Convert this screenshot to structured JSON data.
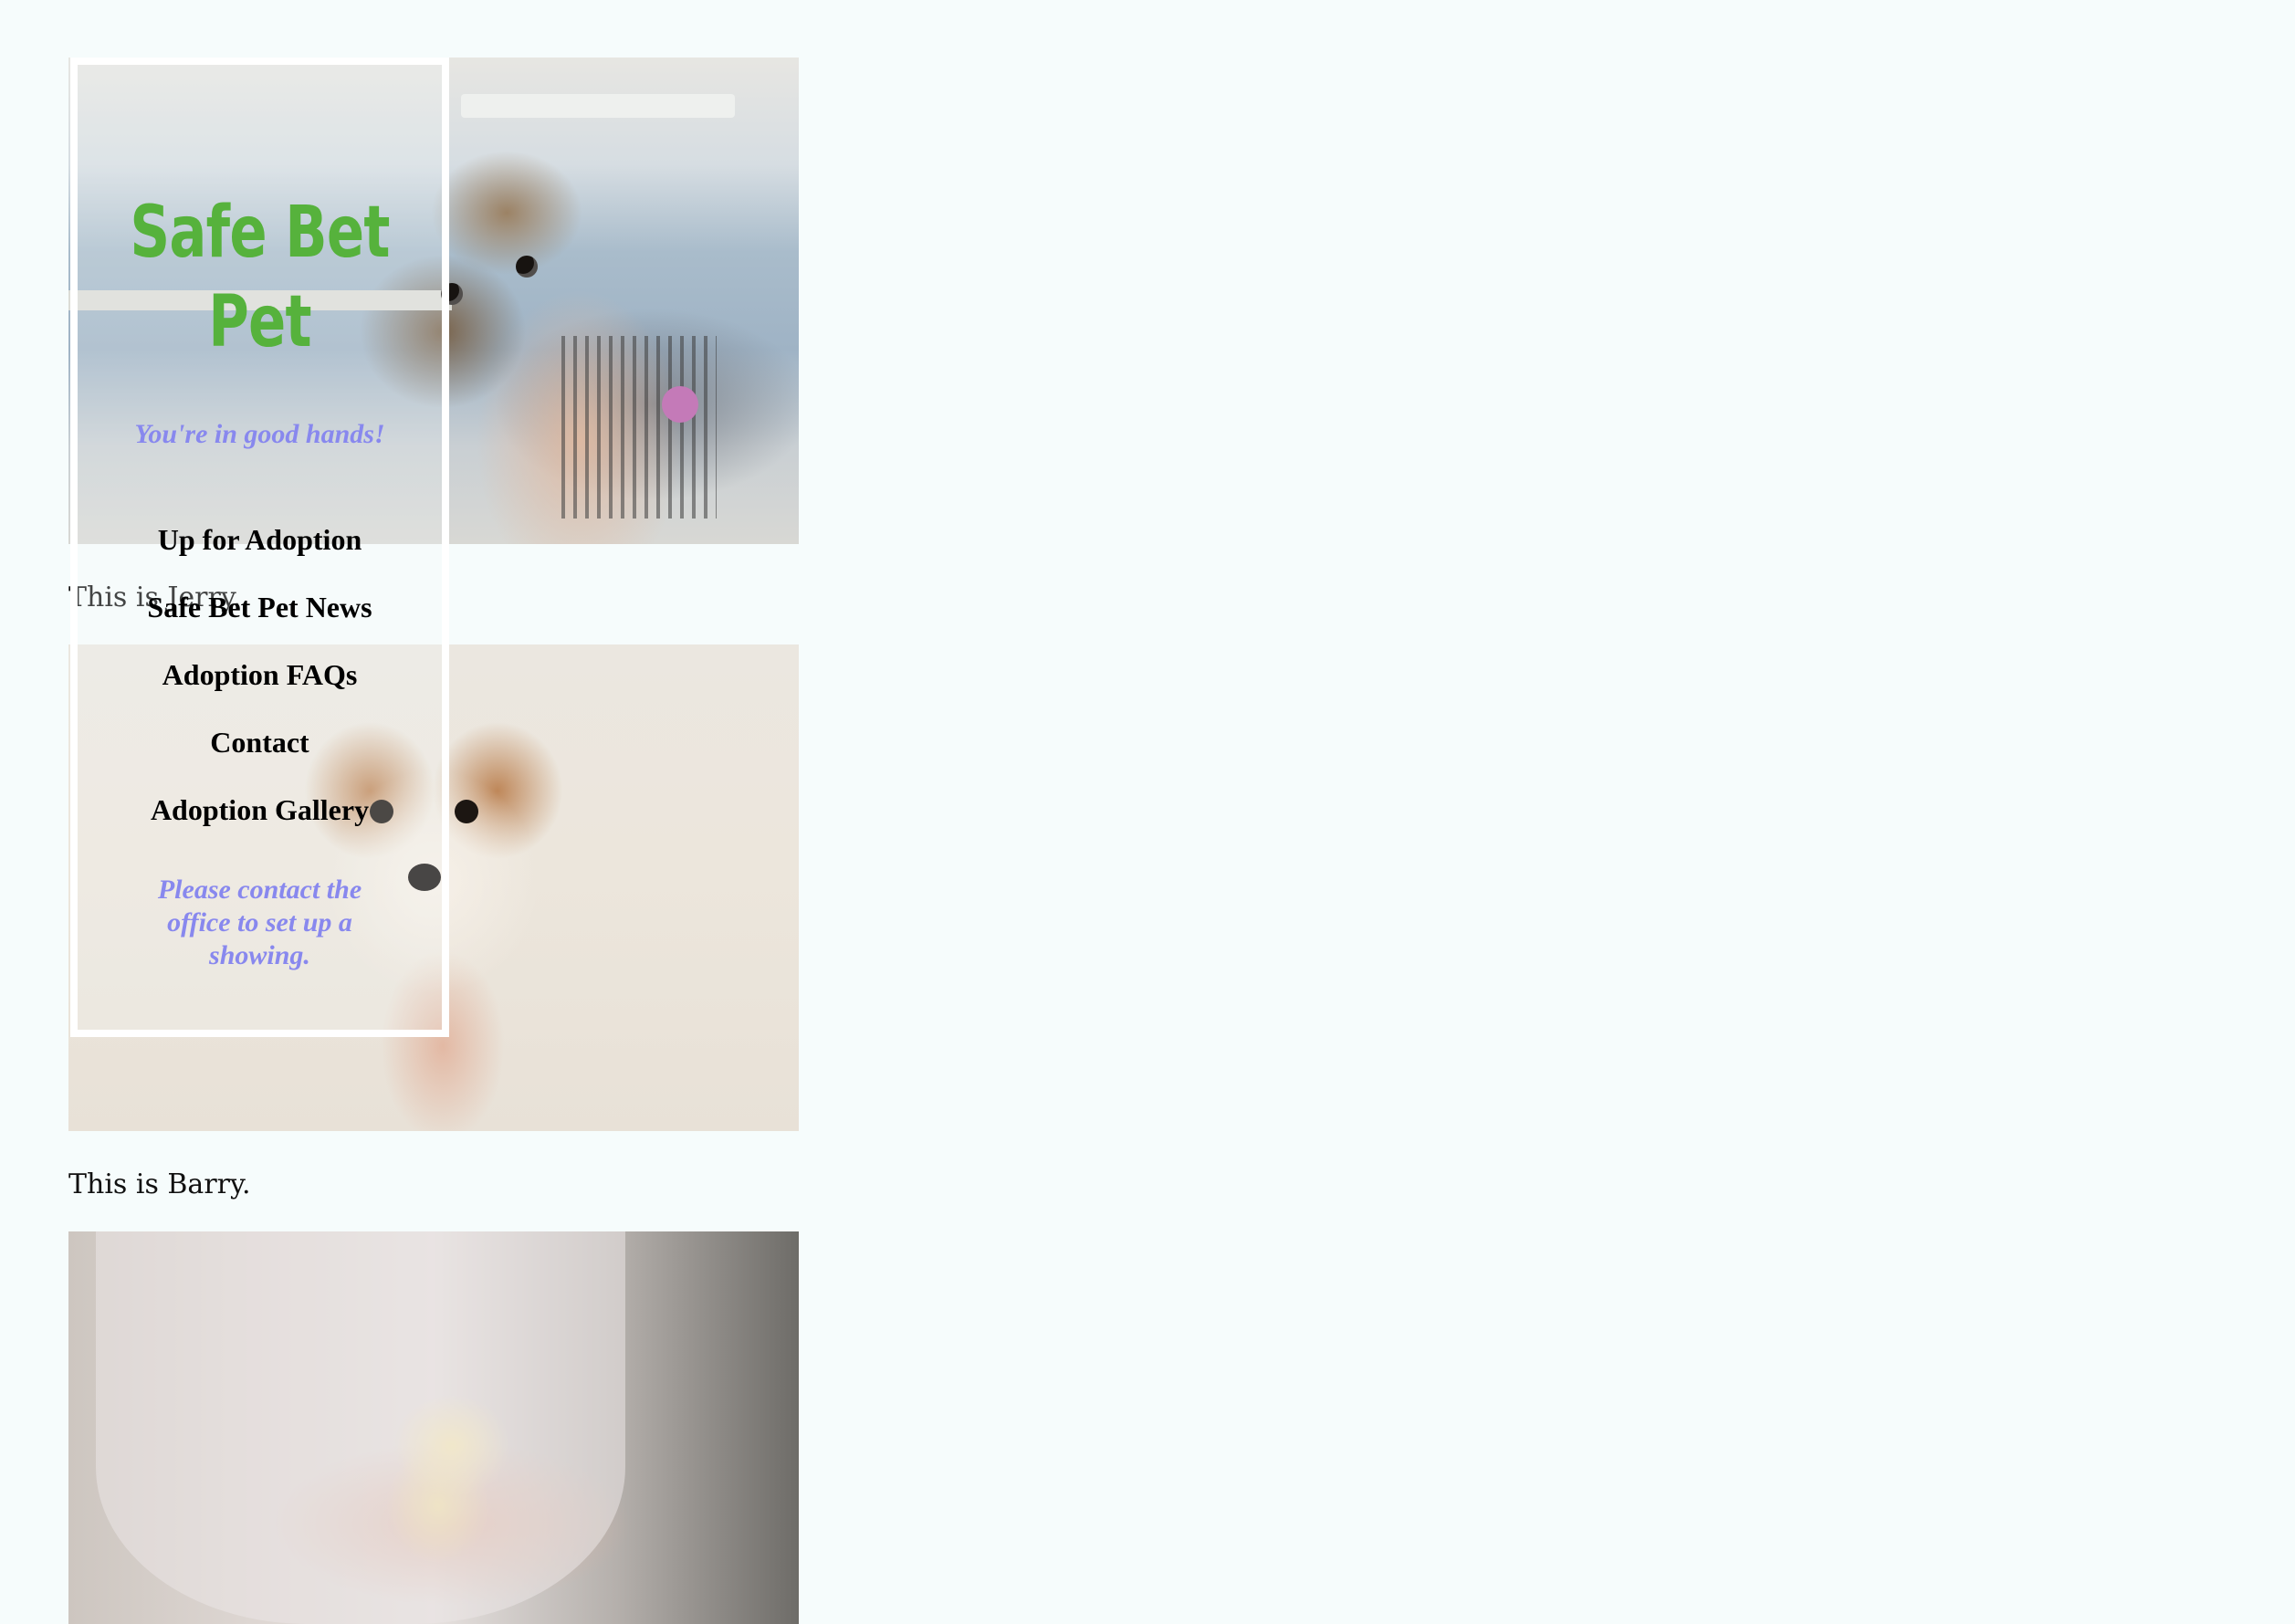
{
  "site": {
    "title": "Safe Bet Pet",
    "tagline": "You're in good hands!",
    "title_color": "#56b23c",
    "accent_color": "#8888ee"
  },
  "nav": {
    "items": [
      {
        "label": "Up for Adoption"
      },
      {
        "label": "Safe Bet Pet News"
      },
      {
        "label": "Adoption FAQs"
      },
      {
        "label": "Contact"
      },
      {
        "label": "Adoption Gallery"
      }
    ]
  },
  "sidebar": {
    "notice": "Please contact the office to set up a showing."
  },
  "gallery": {
    "items": [
      {
        "image": "kitten-photo",
        "caption": "This is Jerry."
      },
      {
        "image": "puppy-photo",
        "caption": "This is Barry."
      },
      {
        "image": "chick-photo",
        "caption": ""
      }
    ]
  }
}
